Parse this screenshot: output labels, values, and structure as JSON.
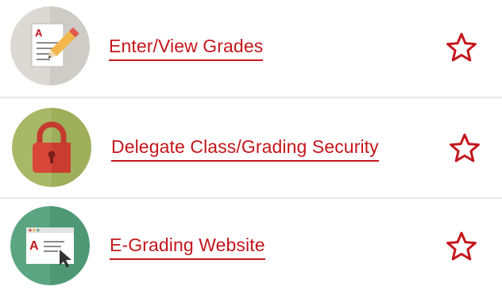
{
  "items": [
    {
      "label": "Enter/View Grades",
      "icon": "grade-sheet-pencil-icon",
      "favorite": false
    },
    {
      "label": "Delegate Class/Grading Security",
      "icon": "padlock-icon",
      "favorite": false
    },
    {
      "label": "E-Grading Website",
      "icon": "browser-window-cursor-icon",
      "favorite": false
    }
  ],
  "icon_letter": "A",
  "colors": {
    "link": "#c4161c",
    "star": "#c4161c",
    "divider": "#e6e6e6",
    "icon1_bg": "#d9d6d2",
    "icon2_bg": "#a9b866",
    "icon3_bg": "#5ba582"
  }
}
